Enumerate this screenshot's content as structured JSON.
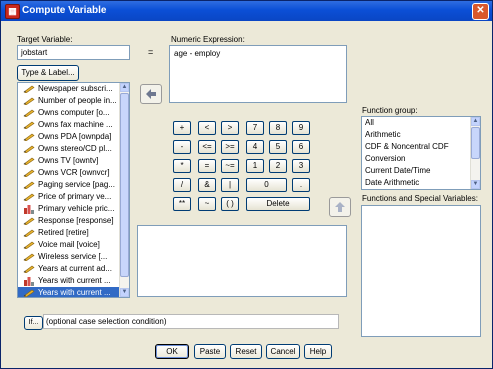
{
  "window": {
    "title": "Compute Variable",
    "close_glyph": "✕"
  },
  "target": {
    "label": "Target Variable:",
    "value": "jobstart",
    "type_label_button": "Type & Label...",
    "equals": "="
  },
  "expression": {
    "label": "Numeric Expression:",
    "value": "age - employ"
  },
  "variables": [
    {
      "label": "Newspaper subscri...",
      "icon": "pencil-icon"
    },
    {
      "label": "Number of people in...",
      "icon": "pencil-icon"
    },
    {
      "label": "Owns computer [o...",
      "icon": "pencil-icon"
    },
    {
      "label": "Owns fax machine ...",
      "icon": "pencil-icon"
    },
    {
      "label": "Owns PDA [ownpda]",
      "icon": "pencil-icon"
    },
    {
      "label": "Owns stereo/CD pl...",
      "icon": "pencil-icon"
    },
    {
      "label": "Owns TV [owntv]",
      "icon": "pencil-icon"
    },
    {
      "label": "Owns VCR [ownvcr]",
      "icon": "pencil-icon"
    },
    {
      "label": "Paging service [pag...",
      "icon": "pencil-icon"
    },
    {
      "label": "Price of primary ve...",
      "icon": "pencil-icon"
    },
    {
      "label": "Primary vehicle pric...",
      "icon": "bar-chart-icon"
    },
    {
      "label": "Response [response]",
      "icon": "pencil-icon"
    },
    {
      "label": "Retired [retire]",
      "icon": "pencil-icon"
    },
    {
      "label": "Voice mail [voice]",
      "icon": "pencil-icon"
    },
    {
      "label": "Wireless service [...",
      "icon": "pencil-icon"
    },
    {
      "label": "Years at current ad...",
      "icon": "pencil-icon"
    },
    {
      "label": "Years with current ...",
      "icon": "bar-chart-icon"
    },
    {
      "label": "Years with current ...",
      "icon": "pencil-icon"
    }
  ],
  "selected_variable_index": 17,
  "keypad": {
    "row1": [
      "+",
      "<",
      ">",
      "7",
      "8",
      "9"
    ],
    "row2": [
      "-",
      "<=",
      ">=",
      "4",
      "5",
      "6"
    ],
    "row3": [
      "*",
      "=",
      "~=",
      "1",
      "2",
      "3"
    ],
    "row4": [
      "/",
      "&",
      "|",
      "0",
      "."
    ],
    "row5": [
      "**",
      "~",
      "( )",
      "Delete"
    ]
  },
  "function_group": {
    "label": "Function group:",
    "items": [
      "All",
      "Arithmetic",
      "CDF & Noncentral CDF",
      "Conversion",
      "Current Date/Time",
      "Date Arithmetic"
    ]
  },
  "functions": {
    "label": "Functions and Special Variables:"
  },
  "if_condition": {
    "button": "If...",
    "text": "(optional case selection condition)"
  },
  "buttons": {
    "ok": "OK",
    "paste": "Paste",
    "reset": "Reset",
    "cancel": "Cancel",
    "help": "Help"
  },
  "colors": {
    "title_bar": "#0b4fd6",
    "selection": "#316ac5",
    "dialog_bg": "#ece9d8",
    "close_button": "#d9572c"
  }
}
